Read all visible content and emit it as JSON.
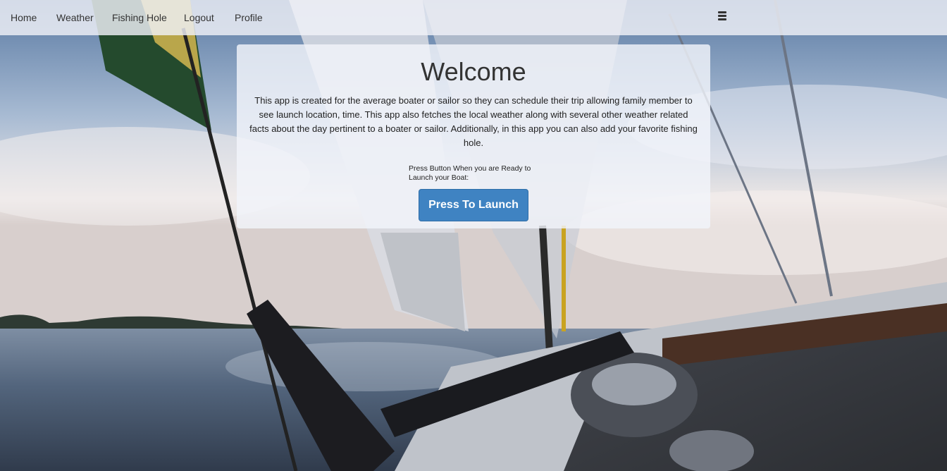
{
  "nav": {
    "items": [
      {
        "label": "Home"
      },
      {
        "label": "Weather"
      },
      {
        "label": "Fishing Hole"
      },
      {
        "label": "Logout"
      },
      {
        "label": "Profile"
      }
    ],
    "menu_icon": "hamburger-menu-icon"
  },
  "welcome": {
    "title": "Welcome",
    "description": "This app is created for the average boater or sailor so they can schedule their trip allowing family member to see launch location, time. This app also fetches the local weather along with several other weather related facts about the day pertinent to a boater or sailor. Additionally, in this app you can also add your favorite fishing hole.",
    "launch_prompt": "Press Button When you are Ready to Launch your Boat:",
    "launch_button": "Press To Launch"
  },
  "colors": {
    "navbar_bg": "#f0f2f8",
    "card_bg": "#f1f4fa",
    "button_bg": "#3f83c2",
    "text": "#333333"
  }
}
